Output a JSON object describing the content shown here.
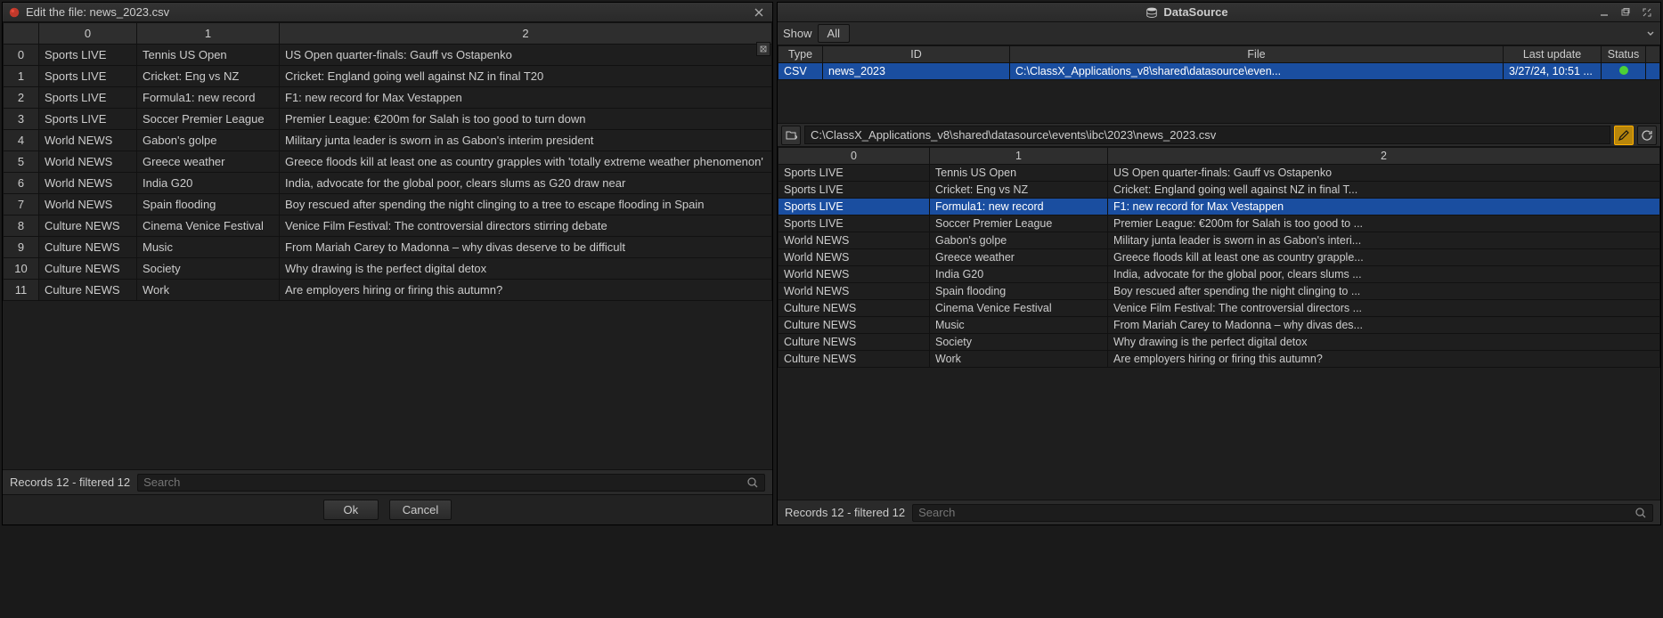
{
  "left": {
    "title": "Edit the file: news_2023.csv",
    "headers": [
      "0",
      "1",
      "2"
    ],
    "rows": [
      {
        "idx": "0",
        "c0": "Sports LIVE",
        "c1": "Tennis US Open",
        "c2": "US Open quarter-finals: Gauff vs Ostapenko"
      },
      {
        "idx": "1",
        "c0": "Sports LIVE",
        "c1": "Cricket: Eng vs NZ",
        "c2": "Cricket: England going well against NZ in final T20"
      },
      {
        "idx": "2",
        "c0": "Sports LIVE",
        "c1": "Formula1: new record",
        "c2": "F1: new record for Max Vestappen"
      },
      {
        "idx": "3",
        "c0": "Sports LIVE",
        "c1": "Soccer Premier League",
        "c2": "Premier League: €200m for Salah is too good to turn down"
      },
      {
        "idx": "4",
        "c0": "World NEWS",
        "c1": "Gabon's golpe",
        "c2": "Military junta leader is sworn in as Gabon's interim president"
      },
      {
        "idx": "5",
        "c0": "World NEWS",
        "c1": "Greece weather",
        "c2": "Greece floods kill at least one as country grapples with 'totally extreme weather phenomenon'"
      },
      {
        "idx": "6",
        "c0": "World NEWS",
        "c1": "India G20",
        "c2": "India, advocate for the global poor, clears slums as G20 draw near"
      },
      {
        "idx": "7",
        "c0": "World NEWS",
        "c1": "Spain flooding",
        "c2": "Boy rescued after spending the night clinging to a tree to escape flooding in Spain"
      },
      {
        "idx": "8",
        "c0": "Culture NEWS",
        "c1": "Cinema Venice Festival",
        "c2": "Venice Film Festival: The controversial directors stirring debate"
      },
      {
        "idx": "9",
        "c0": "Culture NEWS",
        "c1": "Music",
        "c2": "From Mariah Carey to Madonna – why divas deserve to be difficult"
      },
      {
        "idx": "10",
        "c0": "Culture NEWS",
        "c1": "Society",
        "c2": "Why drawing is the perfect digital detox"
      },
      {
        "idx": "11",
        "c0": "Culture NEWS",
        "c1": "Work",
        "c2": "Are employers hiring or firing this autumn?"
      }
    ],
    "records": "Records 12 - filtered 12",
    "search_placeholder": "Search",
    "ok": "Ok",
    "cancel": "Cancel"
  },
  "right": {
    "title": "DataSource",
    "show_label": "Show",
    "filter": "All",
    "list_headers": {
      "type": "Type",
      "id": "ID",
      "file": "File",
      "last": "Last update",
      "status": "Status"
    },
    "list_row": {
      "type": "CSV",
      "id": "news_2023",
      "file": "C:\\ClassX_Applications_v8\\shared\\datasource\\even...",
      "last": "3/27/24, 10:51 ..."
    },
    "path": "C:\\ClassX_Applications_v8\\shared\\datasource\\events\\ibc\\2023\\news_2023.csv",
    "headers": [
      "0",
      "1",
      "2"
    ],
    "rows": [
      {
        "c0": "Sports LIVE",
        "c1": "Tennis US Open",
        "c2": "US Open quarter-finals: Gauff vs Ostapenko"
      },
      {
        "c0": "Sports LIVE",
        "c1": "Cricket: Eng vs NZ",
        "c2": "Cricket: England going well against NZ in final T..."
      },
      {
        "c0": "Sports LIVE",
        "c1": "Formula1: new record",
        "c2": "F1: new record for Max Vestappen",
        "sel": true
      },
      {
        "c0": "Sports LIVE",
        "c1": "Soccer Premier League",
        "c2": "Premier League: €200m for Salah is too good to ..."
      },
      {
        "c0": "World NEWS",
        "c1": "Gabon's golpe",
        "c2": "Military junta leader is sworn in as Gabon's interi..."
      },
      {
        "c0": "World NEWS",
        "c1": "Greece weather",
        "c2": "Greece floods kill at least one as country grapple..."
      },
      {
        "c0": "World NEWS",
        "c1": "India G20",
        "c2": "India, advocate for the global poor, clears slums ..."
      },
      {
        "c0": "World NEWS",
        "c1": "Spain flooding",
        "c2": "Boy rescued after spending the night clinging to ..."
      },
      {
        "c0": "Culture NEWS",
        "c1": "Cinema Venice Festival",
        "c2": "Venice Film Festival: The controversial directors ..."
      },
      {
        "c0": "Culture NEWS",
        "c1": "Music",
        "c2": "From Mariah Carey to Madonna – why divas des..."
      },
      {
        "c0": "Culture NEWS",
        "c1": "Society",
        "c2": "Why drawing is the perfect digital detox"
      },
      {
        "c0": "Culture NEWS",
        "c1": "Work",
        "c2": "Are employers hiring or firing this autumn?"
      }
    ],
    "records": "Records 12 - filtered 12",
    "search_placeholder": "Search"
  }
}
